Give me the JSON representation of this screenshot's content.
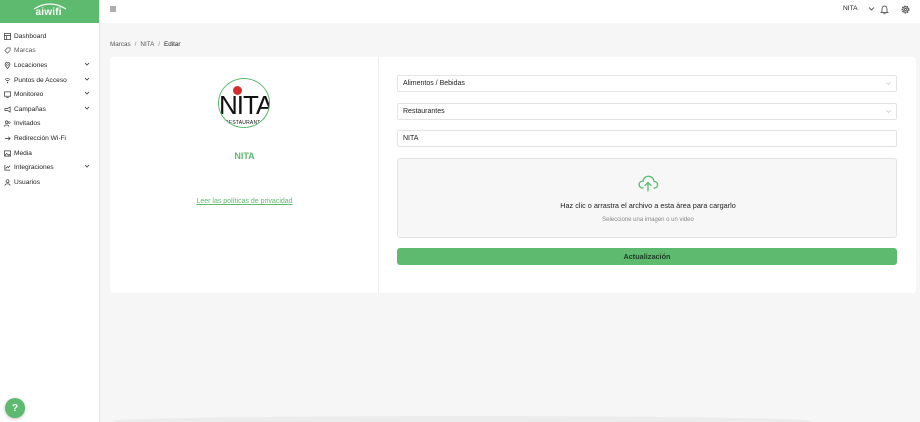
{
  "app": {
    "logo_text": "aiwifi",
    "accent_color": "#5dba6f"
  },
  "sidebar": {
    "items": [
      {
        "label": "Dashboard",
        "icon": "dashboard-icon",
        "has_submenu": false
      },
      {
        "label": "Marcas",
        "icon": "brand-icon",
        "has_submenu": false,
        "active": true
      },
      {
        "label": "Locaciones",
        "icon": "location-pin-icon",
        "has_submenu": true
      },
      {
        "label": "Puntos de Acceso",
        "icon": "access-point-icon",
        "has_submenu": true
      },
      {
        "label": "Monitoreo",
        "icon": "monitor-icon",
        "has_submenu": true
      },
      {
        "label": "Campañas",
        "icon": "megaphone-icon",
        "has_submenu": true
      },
      {
        "label": "Invitados",
        "icon": "users-icon",
        "has_submenu": false
      },
      {
        "label": "Redirección Wi-Fi",
        "icon": "redirect-icon",
        "has_submenu": false
      },
      {
        "label": "Media",
        "icon": "media-icon",
        "has_submenu": false
      },
      {
        "label": "Integraciones",
        "icon": "integrations-icon",
        "has_submenu": true
      },
      {
        "label": "Usuarios",
        "icon": "user-icon",
        "has_submenu": false
      }
    ],
    "help_label": "?"
  },
  "topbar": {
    "selected_brand": "NITA"
  },
  "breadcrumb": {
    "items": [
      "Marcas",
      "NITA",
      "Editar"
    ]
  },
  "brand": {
    "logo_word": "NITA",
    "logo_sub": "RESTAURANT",
    "name": "NITA",
    "privacy_link": "Leer las políticas de privacidad"
  },
  "form": {
    "category": "Alimentos / Bebidas",
    "subcategory": "Restaurantes",
    "name_value": "NITA",
    "upload_title": "Haz clic o arrastra el archivo a esta área para cargarlo",
    "upload_hint": "Seleccione una imagen o un video",
    "submit_label": "Actualización"
  }
}
